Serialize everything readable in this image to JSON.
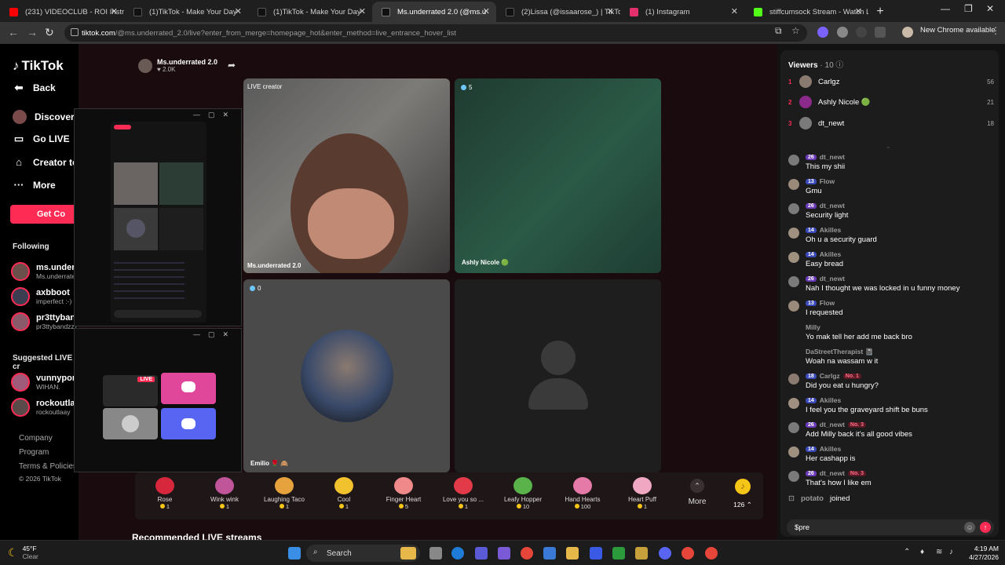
{
  "tabs": [
    {
      "title": "(231) VIDEOCLUB - ROI Instrum",
      "color": "#ff0000"
    },
    {
      "title": "(1)TikTok - Make Your Day",
      "color": "#ffffff"
    },
    {
      "title": "(1)TikTok - Make Your Day",
      "color": "#ffffff"
    },
    {
      "title": "Ms.underrated 2.0 (@ms.u",
      "color": "#ffffff",
      "active": true
    },
    {
      "title": "(2)Lissa (@issaarose_) | TikTok",
      "color": "#ffffff"
    },
    {
      "title": "(1) Instagram",
      "color": "#e1306c"
    },
    {
      "title": "stiffcumsock Stream - Watch Li",
      "color": "#53fc18"
    }
  ],
  "address": {
    "host": "tiktok.com",
    "path": "/@ms.underrated_2.0/live?enter_from_merge=homepage_hot&enter_method=live_entrance_hover_list",
    "new_chrome": "New Chrome available"
  },
  "sidebar": {
    "logo": "TikTok",
    "back": "Back",
    "discover": "Discover L",
    "go_live": "Go LIVE",
    "creator_tools": "Creator to",
    "more": "More",
    "get_coins": "Get Co",
    "following_title": "Following",
    "following": [
      {
        "name": "ms.underr",
        "sub": "Ms.underrate"
      },
      {
        "name": "axbboot",
        "sub": "imperfect :-)"
      },
      {
        "name": "pr3ttyban",
        "sub": "pr3ttybandzzz"
      }
    ],
    "suggested_title": "Suggested LIVE cr",
    "suggested": [
      {
        "name": "vunnypom",
        "sub": "WIHAN."
      },
      {
        "name": "rockoutlaa",
        "sub": "rockoutlaay"
      }
    ],
    "footer": [
      "Company",
      "Program",
      "Terms & Policies"
    ],
    "copyright": "© 2026 TikTok"
  },
  "live": {
    "host_name": "Ms.underrated 2.0",
    "host_likes": "♥ 2.0K",
    "tiles": {
      "creator_label": "LIVE creator",
      "creator_name": "Ms.underrated 2.0",
      "ashly_count": "5",
      "ashly_name": "Ashly Nicole 🟢",
      "emilio_count": "0",
      "emilio_name": "Emilio 🌹 🙈"
    },
    "gifts": [
      {
        "name": "Rose",
        "price": "1",
        "color": "#d6273d"
      },
      {
        "name": "Wink wink",
        "price": "1",
        "color": "#c0559a"
      },
      {
        "name": "Laughing Taco",
        "price": "1",
        "color": "#e6a23c"
      },
      {
        "name": "Cool",
        "price": "1",
        "color": "#f2c12e"
      },
      {
        "name": "Finger Heart",
        "price": "5",
        "color": "#f08a8a"
      },
      {
        "name": "Love you so ...",
        "price": "1",
        "color": "#e33a4a"
      },
      {
        "name": "Leafy Hopper",
        "price": "10",
        "color": "#5ab24a"
      },
      {
        "name": "Hand Hearts",
        "price": "100",
        "color": "#e57aa8"
      },
      {
        "name": "Heart Puff",
        "price": "1",
        "color": "#f0a7c2"
      }
    ],
    "more_label": "More",
    "balance": "126",
    "recommended_title": "Recommended LIVE streams"
  },
  "mini_window": {
    "live_badge": "LIVE"
  },
  "chat": {
    "viewers_label": "Viewers",
    "viewers_count": "· 10",
    "ranking": [
      {
        "pos": "1",
        "name": "Carlgz",
        "score": "56",
        "color": "#8a7a70"
      },
      {
        "pos": "2",
        "name": "Ashly Nicole 🟢",
        "score": "21",
        "color": "#8b2a8a"
      },
      {
        "pos": "3",
        "name": "dt_newt",
        "score": "18",
        "color": "#7a7a7a"
      }
    ],
    "messages": [
      {
        "user": "dt_newt",
        "level": "26",
        "text": "This my shii",
        "badge": ""
      },
      {
        "user": "Flow",
        "level": "13",
        "text": "Gmu",
        "badge": ""
      },
      {
        "user": "dt_newt",
        "level": "26",
        "text": "Security light",
        "badge": ""
      },
      {
        "user": "Akilles",
        "level": "14",
        "text": "Oh u a security guard",
        "badge": ""
      },
      {
        "user": "Akilles",
        "level": "14",
        "text": "Easy bread",
        "badge": ""
      },
      {
        "user": "dt_newt",
        "level": "26",
        "text": "Nah I thought we was locked in u funny money",
        "badge": ""
      },
      {
        "user": "Flow",
        "level": "13",
        "text": "I requested",
        "badge": ""
      },
      {
        "user": "Milly",
        "level": "",
        "text": "Yo mak tell her add me back bro",
        "badge": ""
      },
      {
        "user": "DaStreetTherapist 📓",
        "level": "",
        "text": "Woah na wassam w it",
        "badge": ""
      },
      {
        "user": "Carlgz",
        "level": "18",
        "text": "Did you eat u hungry?",
        "badge": "No. 1"
      },
      {
        "user": "Akilles",
        "level": "14",
        "text": "I feel you the graveyard shift be buns",
        "badge": ""
      },
      {
        "user": "dt_newt",
        "level": "26",
        "text": "Add Milly back it's all good vibes",
        "badge": "No. 3"
      },
      {
        "user": "Akilles",
        "level": "14",
        "text": "Her cashapp is",
        "badge": ""
      },
      {
        "user": "dt_newt",
        "level": "26",
        "text": "That's how I like em",
        "badge": "No. 3"
      }
    ],
    "joined_user": "potato",
    "joined_text": "joined",
    "input_value": "$pre"
  },
  "taskbar": {
    "temp": "45°F",
    "weather": "Clear",
    "search": "Search",
    "time": "4:19 AM",
    "date": "4/27/2026"
  }
}
